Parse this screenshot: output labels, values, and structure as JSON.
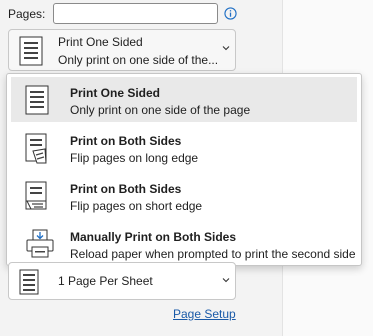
{
  "pages": {
    "label": "Pages:",
    "value": "",
    "placeholder": ""
  },
  "sides_select": {
    "title": "Print One Sided",
    "subtitle": "Only print on one side of the..."
  },
  "sides_options": [
    {
      "title": "Print One Sided",
      "subtitle": "Only print on one side of the page",
      "icon": "one-sided-page-icon",
      "selected": true
    },
    {
      "title": "Print on Both Sides",
      "subtitle": "Flip pages on long edge",
      "icon": "long-edge-flip-icon",
      "selected": false
    },
    {
      "title": "Print on Both Sides",
      "subtitle": "Flip pages on short edge",
      "icon": "short-edge-flip-icon",
      "selected": false
    },
    {
      "title": "Manually Print on Both Sides",
      "subtitle": "Reload paper when prompted to print the second side",
      "icon": "manual-duplex-printer-icon",
      "selected": false
    }
  ],
  "pages_per_sheet": {
    "value": "1 Page Per Sheet"
  },
  "page_setup_link": "Page Setup",
  "colors": {
    "accent": "#1a5aa8",
    "info": "#1f6fc5",
    "hover": "#e9e9e9"
  }
}
